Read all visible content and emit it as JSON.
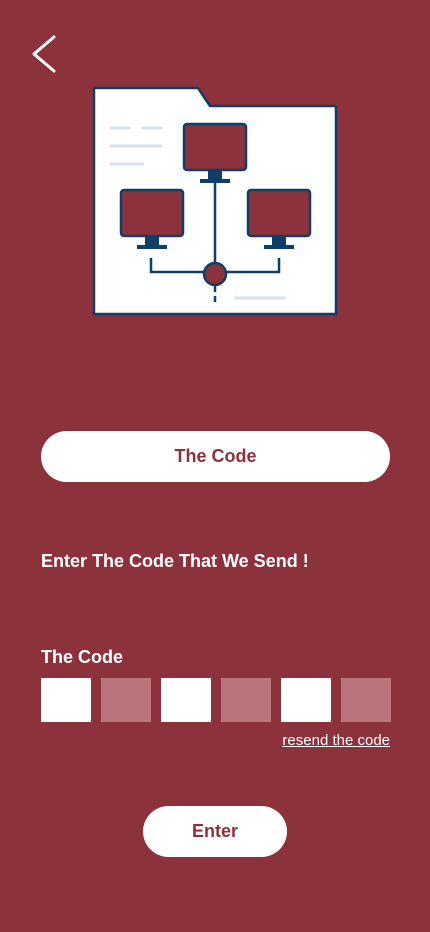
{
  "header": {
    "back_icon": "chevron-left-icon"
  },
  "illustration": {
    "icon": "network-folder-illustration",
    "colors": {
      "folder_fill": "#ffffff",
      "outline": "#0F3F66",
      "monitor_screen": "#8C323C",
      "line_light": "#D6E3EE"
    }
  },
  "title_pill": {
    "label": "The Code"
  },
  "instruction": {
    "text": "Enter The Code That We Send !"
  },
  "code_entry": {
    "label": "The Code",
    "digits": [
      "",
      "",
      "",
      "",
      "",
      ""
    ],
    "resend_label": "resend the code"
  },
  "enter_button": {
    "label": "Enter"
  },
  "theme": {
    "background": "#8C323C",
    "surface": "#ffffff",
    "box_dim": "#BA757C"
  }
}
